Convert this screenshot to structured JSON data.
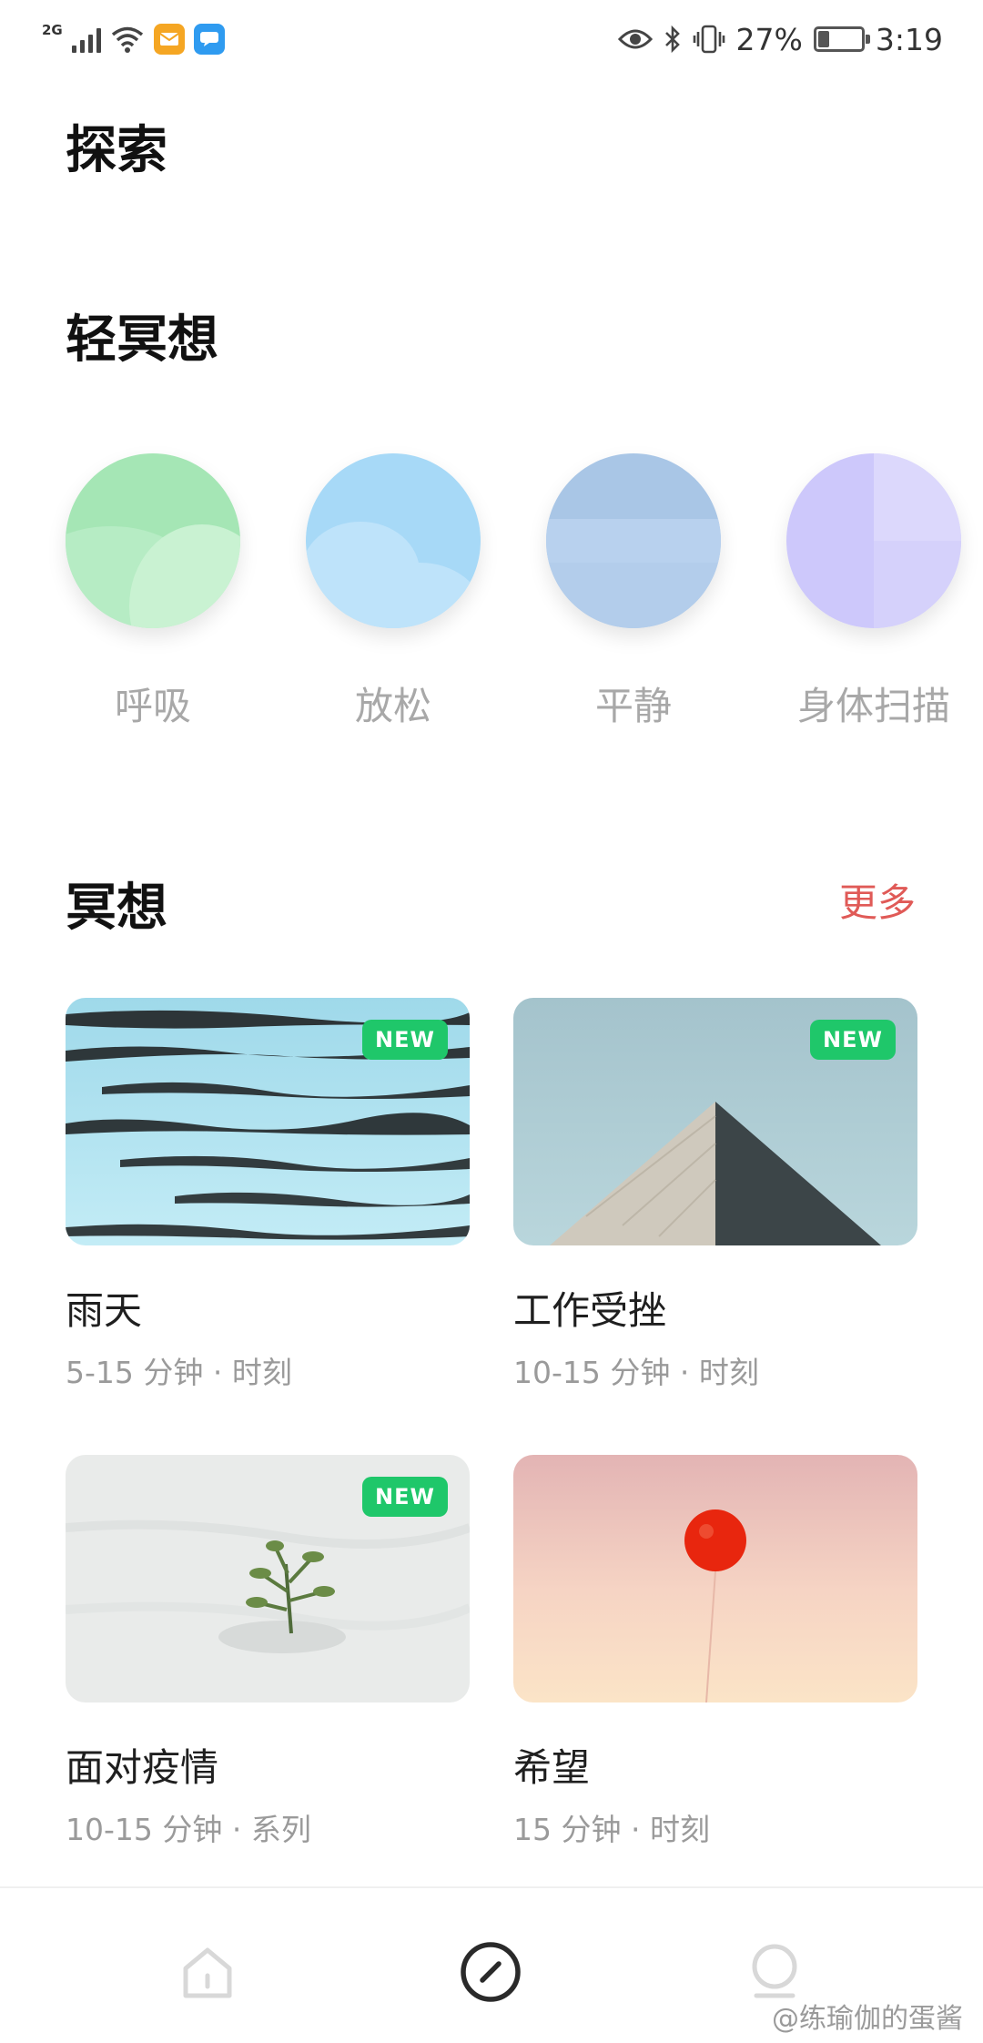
{
  "status_bar": {
    "network": "2G",
    "battery": "27%",
    "battery_level": 0.27,
    "time": "3:19",
    "icons": [
      "signal-icon",
      "wifi-icon",
      "mail-app-icon",
      "chat-app-icon",
      "eye-icon",
      "bluetooth-icon",
      "vibrate-icon",
      "battery-icon"
    ]
  },
  "page": {
    "title": "探索"
  },
  "light_meditation": {
    "title": "轻冥想",
    "items": [
      {
        "label": "呼吸",
        "color": "#a5e6b5"
      },
      {
        "label": "放松",
        "color": "#a7d9f7"
      },
      {
        "label": "平静",
        "color": "#a9c6e6"
      },
      {
        "label": "身体扫描",
        "color": "#cdc8fb"
      }
    ]
  },
  "meditation": {
    "title": "冥想",
    "more_label": "更多",
    "cards": [
      {
        "title": "雨天",
        "meta": "5-15 分钟 · 时刻",
        "badge": "NEW"
      },
      {
        "title": "工作受挫",
        "meta": "10-15 分钟 · 时刻",
        "badge": "NEW"
      },
      {
        "title": "面对疫情",
        "meta": "10-15 分钟 · 系列",
        "badge": "NEW"
      },
      {
        "title": "希望",
        "meta": "15 分钟 · 时刻",
        "badge": ""
      }
    ]
  },
  "bottom_nav": {
    "items": [
      "home-icon",
      "compass-icon",
      "profile-icon"
    ],
    "active": "compass-icon"
  },
  "watermark": "@练瑜伽的蛋酱",
  "colors": {
    "accent": "#e05a57",
    "badge": "#1fc76a"
  }
}
